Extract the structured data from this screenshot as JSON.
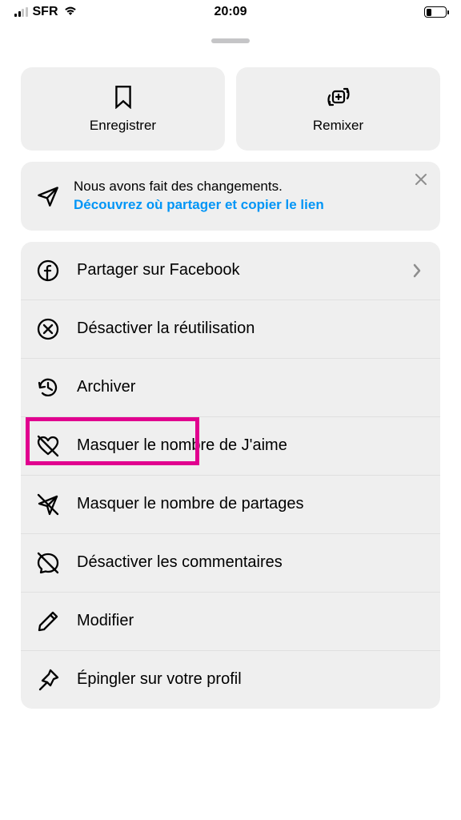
{
  "status_bar": {
    "carrier": "SFR",
    "time": "20:09"
  },
  "top_actions": {
    "save_label": "Enregistrer",
    "remix_label": "Remixer"
  },
  "notice": {
    "line1": "Nous avons fait des changements.",
    "link": "Découvrez où partager et copier le lien"
  },
  "menu": {
    "share_facebook": "Partager sur Facebook",
    "disable_reuse": "Désactiver la réutilisation",
    "archive": "Archiver",
    "hide_likes": "Masquer le nombre de J'aime",
    "hide_shares": "Masquer le nombre de partages",
    "disable_comments": "Désactiver les commentaires",
    "edit": "Modifier",
    "pin_profile": "Épingler sur votre profil"
  }
}
